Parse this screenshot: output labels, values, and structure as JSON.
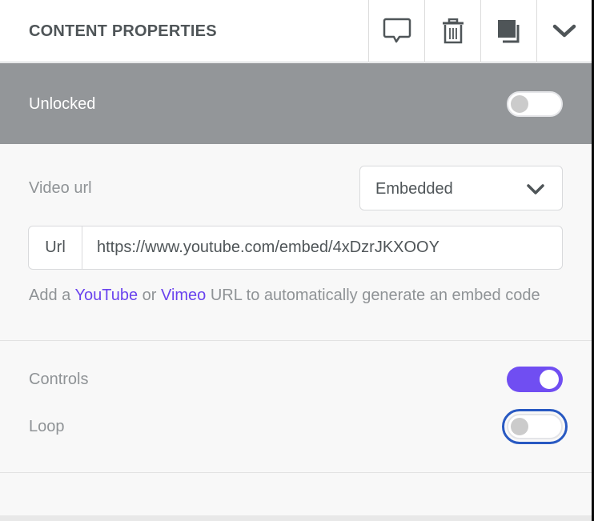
{
  "header": {
    "title": "CONTENT PROPERTIES",
    "actions": [
      {
        "name": "comment",
        "icon": "comment-icon"
      },
      {
        "name": "delete",
        "icon": "trash-icon"
      },
      {
        "name": "duplicate",
        "icon": "duplicate-icon"
      },
      {
        "name": "collapse",
        "icon": "chevron-down-icon"
      }
    ]
  },
  "lock": {
    "label": "Unlocked",
    "enabled": false
  },
  "video": {
    "label": "Video url",
    "source_select": {
      "value": "Embedded"
    },
    "url": {
      "addon_label": "Url",
      "value": "https://www.youtube.com/embed/4xDzrJKXOOY"
    },
    "help": {
      "prefix": "Add a ",
      "link1": "YouTube",
      "middle": " or ",
      "link2": "Vimeo",
      "suffix": " URL to automatically generate an embed code"
    }
  },
  "options": {
    "controls": {
      "label": "Controls",
      "enabled": true
    },
    "loop": {
      "label": "Loop",
      "enabled": false,
      "focused": true
    }
  },
  "colors": {
    "accent": "#704ef2",
    "link": "#6a43ee",
    "lock_bar": "#939699",
    "focus_ring": "#2859c2"
  }
}
